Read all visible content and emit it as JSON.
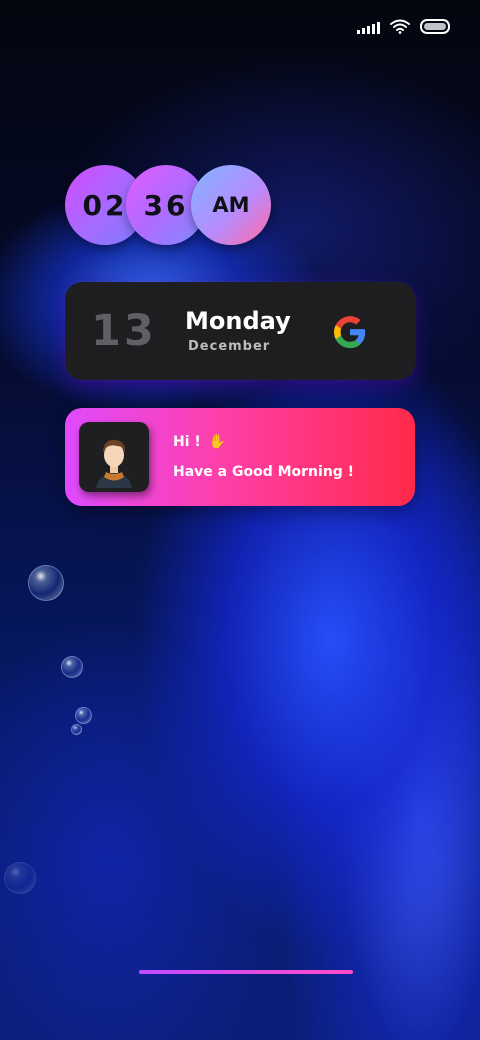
{
  "status_bar": {
    "signal_icon": "cellular-signal-icon",
    "wifi_icon": "wifi-icon",
    "battery_icon": "battery-icon"
  },
  "clock": {
    "hour": "02",
    "minute": "36",
    "period": "AM"
  },
  "date_widget": {
    "day": "13",
    "weekday": "Monday",
    "month": "December",
    "logo": "google-g-icon"
  },
  "greeting_widget": {
    "hi": "Hi !",
    "wave_icon": "waving-hand-icon",
    "message": "Have a Good Morning !",
    "avatar": "user-avatar"
  },
  "colors": {
    "bubble_pink": "#d24cff",
    "bubble_blue": "#7fb6ff",
    "card_dark": "#1e1e20",
    "greet_start": "#e04bff",
    "greet_end": "#ff2a4a",
    "home_indicator": "#c14cff"
  }
}
